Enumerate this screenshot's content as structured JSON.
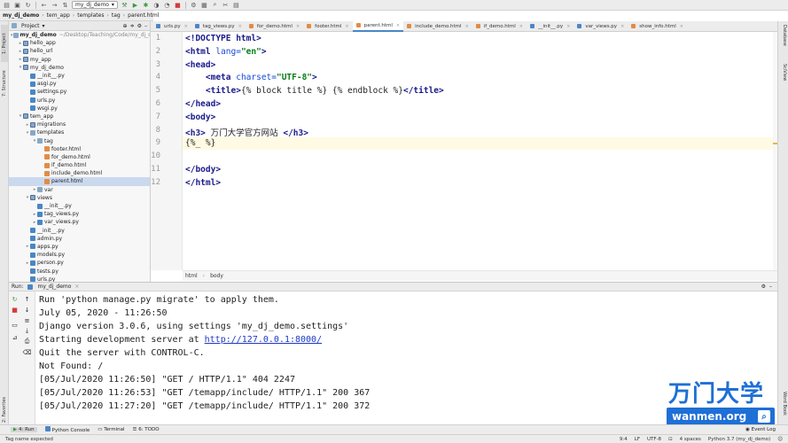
{
  "toolbar": {
    "run_config": "my_dj_demo"
  },
  "breadcrumb": [
    "my_dj_demo",
    "tem_app",
    "templates",
    "tag",
    "parent.html"
  ],
  "left_stripe": {
    "project": "1: Project",
    "structure": "7: Structure",
    "favorites": "2: Favorites"
  },
  "right_stripe": {
    "database": "Database",
    "sciview": "SciView",
    "word_book": "Word Book"
  },
  "project_panel": {
    "title": "Project",
    "tree": [
      {
        "label": "my_dj_demo",
        "path": "~/Desktop/Teaching/Code/my_dj_demo",
        "icon": "dir",
        "indent": 0,
        "arrow": "▾",
        "bold": true
      },
      {
        "label": "hello_app",
        "icon": "pkg",
        "indent": 1,
        "arrow": "▸"
      },
      {
        "label": "hello_url",
        "icon": "pkg",
        "indent": 1,
        "arrow": "▸"
      },
      {
        "label": "my_app",
        "icon": "pkg",
        "indent": 1,
        "arrow": "▸"
      },
      {
        "label": "my_dj_demo",
        "icon": "pkg",
        "indent": 1,
        "arrow": "▾"
      },
      {
        "label": "__init__.py",
        "icon": "py",
        "indent": 2,
        "arrow": ""
      },
      {
        "label": "asgi.py",
        "icon": "py",
        "indent": 2,
        "arrow": ""
      },
      {
        "label": "settings.py",
        "icon": "py",
        "indent": 2,
        "arrow": ""
      },
      {
        "label": "urls.py",
        "icon": "py",
        "indent": 2,
        "arrow": ""
      },
      {
        "label": "wsgi.py",
        "icon": "py",
        "indent": 2,
        "arrow": ""
      },
      {
        "label": "tem_app",
        "icon": "pkg",
        "indent": 1,
        "arrow": "▾"
      },
      {
        "label": "migrations",
        "icon": "pkg",
        "indent": 2,
        "arrow": "▸"
      },
      {
        "label": "templates",
        "icon": "dir",
        "indent": 2,
        "arrow": "▾"
      },
      {
        "label": "tag",
        "icon": "dir",
        "indent": 3,
        "arrow": "▾"
      },
      {
        "label": "footer.html",
        "icon": "html",
        "indent": 4,
        "arrow": ""
      },
      {
        "label": "for_demo.html",
        "icon": "html",
        "indent": 4,
        "arrow": ""
      },
      {
        "label": "if_demo.html",
        "icon": "html",
        "indent": 4,
        "arrow": ""
      },
      {
        "label": "include_demo.html",
        "icon": "html",
        "indent": 4,
        "arrow": ""
      },
      {
        "label": "parent.html",
        "icon": "html",
        "indent": 4,
        "arrow": "",
        "selected": true
      },
      {
        "label": "var",
        "icon": "dir",
        "indent": 3,
        "arrow": "▸"
      },
      {
        "label": "views",
        "icon": "pkg",
        "indent": 2,
        "arrow": "▾"
      },
      {
        "label": "__init__.py",
        "icon": "py",
        "indent": 3,
        "arrow": ""
      },
      {
        "label": "tag_views.py",
        "icon": "py",
        "indent": 3,
        "arrow": "▸"
      },
      {
        "label": "var_views.py",
        "icon": "py",
        "indent": 3,
        "arrow": "▸"
      },
      {
        "label": "__init__.py",
        "icon": "py",
        "indent": 2,
        "arrow": ""
      },
      {
        "label": "admin.py",
        "icon": "py",
        "indent": 2,
        "arrow": ""
      },
      {
        "label": "apps.py",
        "icon": "py",
        "indent": 2,
        "arrow": "▸"
      },
      {
        "label": "models.py",
        "icon": "py",
        "indent": 2,
        "arrow": ""
      },
      {
        "label": "person.py",
        "icon": "py",
        "indent": 2,
        "arrow": "▸"
      },
      {
        "label": "tests.py",
        "icon": "py",
        "indent": 2,
        "arrow": ""
      },
      {
        "label": "urls.py",
        "icon": "py",
        "indent": 2,
        "arrow": ""
      }
    ]
  },
  "editor_tabs": [
    {
      "label": "urls.py",
      "icon": "py"
    },
    {
      "label": "tag_views.py",
      "icon": "py"
    },
    {
      "label": "for_demo.html",
      "icon": "html"
    },
    {
      "label": "footer.html",
      "icon": "html"
    },
    {
      "label": "parent.html",
      "icon": "html",
      "active": true
    },
    {
      "label": "include_demo.html",
      "icon": "html"
    },
    {
      "label": "if_demo.html",
      "icon": "html"
    },
    {
      "label": "__init__.py",
      "icon": "py"
    },
    {
      "label": "var_views.py",
      "icon": "py"
    },
    {
      "label": "show_info.html",
      "icon": "html"
    }
  ],
  "code_lines": [
    {
      "n": "1",
      "html": "<span class=\"tag\">&lt;!DOCTYPE html&gt;</span>"
    },
    {
      "n": "2",
      "html": "<span class=\"tag\">&lt;html </span><span class=\"attr\">lang=</span><span class=\"str\">\"en\"</span><span class=\"tag\">&gt;</span>"
    },
    {
      "n": "3",
      "html": "<span class=\"tag\">&lt;head&gt;</span>"
    },
    {
      "n": "4",
      "html": "    <span class=\"tag\">&lt;meta </span><span class=\"attr\">charset=</span><span class=\"str\">\"UTF-8\"</span><span class=\"tag\">&gt;</span>"
    },
    {
      "n": "5",
      "html": "    <span class=\"tag\">&lt;title&gt;</span>{% block title %} {% endblock %}<span class=\"tag\">&lt;/title&gt;</span>"
    },
    {
      "n": "6",
      "html": "<span class=\"tag\">&lt;/head&gt;</span>"
    },
    {
      "n": "7",
      "html": "<span class=\"tag\">&lt;body&gt;</span>"
    },
    {
      "n": "8",
      "html": "<span class=\"tag\">&lt;h3&gt;</span> 万门大学官方网站 <span class=\"tag\">&lt;/h3&gt;</span>"
    },
    {
      "n": "9",
      "html": "{%_ %}",
      "current": true
    },
    {
      "n": "10",
      "html": ""
    },
    {
      "n": "11",
      "html": "<span class=\"tag\">&lt;/body&gt;</span>"
    },
    {
      "n": "12",
      "html": "<span class=\"tag\">&lt;/html&gt;</span>"
    }
  ],
  "editor_breadcrumb": [
    "html",
    "body"
  ],
  "run_panel": {
    "label": "Run:",
    "config": "my_dj_demo",
    "lines": [
      "Run 'python manage.py migrate' to apply them.",
      "July 05, 2020 - 11:26:50",
      "Django version 3.0.6, using settings 'my_dj_demo.settings'",
      "Quit the server with CONTROL-C.",
      "Not Found: /",
      "[05/Jul/2020 11:26:50] \"GET / HTTP/1.1\" 404 2247",
      "[05/Jul/2020 11:26:53] \"GET /temapp/include/ HTTP/1.1\" 200 367",
      "[05/Jul/2020 11:27:20] \"GET /temapp/include/ HTTP/1.1\" 200 372"
    ],
    "server_prefix": "Starting development server at ",
    "server_url": "http://127.0.0.1:8000/"
  },
  "bottom_tabs": [
    "4: Run",
    "Python Console",
    "Terminal",
    "6: TODO"
  ],
  "event_log": "Event Log",
  "status": {
    "message": "Tag name expected",
    "position": "9:4",
    "line_sep": "LF",
    "encoding": "UTF-8",
    "indent": "4 spaces",
    "interpreter": "Python 3.7 (my_dj_demo)"
  },
  "watermark": {
    "brand_cn": "万门大学",
    "brand_url": "wanmen.org"
  },
  "colors": {
    "accent": "#4a86c5",
    "brand": "#1e6fd6",
    "selection": "#cbd9ee"
  }
}
